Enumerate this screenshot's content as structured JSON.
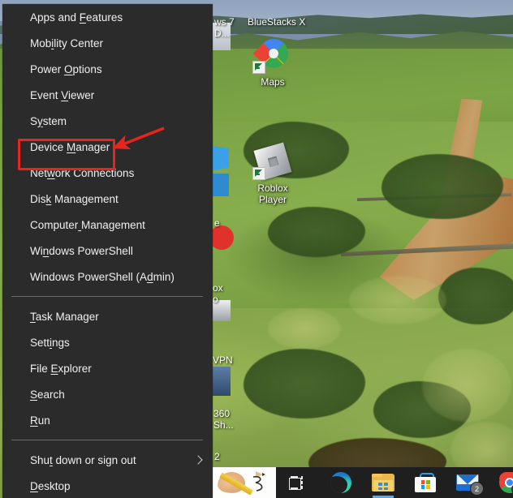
{
  "context_menu": {
    "items": [
      {
        "label": "Apps and Features",
        "accel_index": 9,
        "submenu": false
      },
      {
        "label": "Mobility Center",
        "accel_index": 3,
        "submenu": false
      },
      {
        "label": "Power Options",
        "accel_index": 6,
        "submenu": false
      },
      {
        "label": "Event Viewer",
        "accel_index": 6,
        "submenu": false
      },
      {
        "label": "System",
        "accel_index": 1,
        "submenu": false
      },
      {
        "label": "Device Manager",
        "accel_index": 7,
        "submenu": false
      },
      {
        "label": "Network Connections",
        "accel_index": 3,
        "submenu": false
      },
      {
        "label": "Disk Management",
        "accel_index": 3,
        "submenu": false
      },
      {
        "label": "Computer Management",
        "accel_index": 8,
        "submenu": false
      },
      {
        "label": "Windows PowerShell",
        "accel_index": 2,
        "submenu": false
      },
      {
        "label": "Windows PowerShell (Admin)",
        "accel_index": 21,
        "submenu": false
      },
      {
        "separator": true
      },
      {
        "label": "Task Manager",
        "accel_index": 0,
        "submenu": false
      },
      {
        "label": "Settings",
        "accel_index": 4,
        "submenu": false
      },
      {
        "label": "File Explorer",
        "accel_index": 5,
        "submenu": false
      },
      {
        "label": "Search",
        "accel_index": 0,
        "submenu": false
      },
      {
        "label": "Run",
        "accel_index": 0,
        "submenu": false
      },
      {
        "separator": true
      },
      {
        "label": "Shut down or sign out",
        "accel_index": 3,
        "submenu": true
      },
      {
        "label": "Desktop",
        "accel_index": 0,
        "submenu": false
      }
    ]
  },
  "annotation": {
    "color": "#e8251c",
    "highlighted_item": "Device Manager",
    "shape": "rectangle-with-arrow"
  },
  "desktop": {
    "icons": [
      {
        "name": "windows-7-vhd",
        "label_line1": "ws 7",
        "label_line2": "D...",
        "clipped": true
      },
      {
        "name": "bluestacks-x",
        "label_line1": "BlueStacks X",
        "clipped": true
      },
      {
        "name": "maps",
        "label_line1": "Maps",
        "clipped": false
      },
      {
        "name": "roblox-player",
        "label_line1": "Roblox",
        "label_line2": "Player",
        "clipped": false
      },
      {
        "name": "firefox-partial",
        "label_line1": "ox",
        "label_line2": "o",
        "clipped": true
      },
      {
        "name": "vpn",
        "label_line1": "VPN",
        "clipped": true
      },
      {
        "name": "360-share",
        "label_line1": "360",
        "label_line2": "Sh...",
        "clipped": true
      },
      {
        "name": "item-2",
        "label_line1": "2",
        "clipped": true
      },
      {
        "name": "edge-partial",
        "label_line1": "e",
        "clipped": true
      }
    ]
  },
  "taskbar": {
    "items": [
      {
        "name": "ink-workspace-thumbnail",
        "label": "Pencil sketch preview",
        "badge": null,
        "active": false
      },
      {
        "name": "task-view",
        "label": "Task View",
        "badge": null,
        "active": false
      },
      {
        "name": "microsoft-edge",
        "label": "Microsoft Edge",
        "badge": null,
        "active": false
      },
      {
        "name": "file-explorer",
        "label": "File Explorer",
        "badge": null,
        "active": true
      },
      {
        "name": "microsoft-store",
        "label": "Microsoft Store",
        "badge": null,
        "active": false
      },
      {
        "name": "mail",
        "label": "Mail",
        "badge": "2",
        "active": false
      },
      {
        "name": "google-chrome",
        "label": "Google Chrome",
        "badge": null,
        "active": false
      }
    ]
  },
  "colors": {
    "menu_bg": "#2b2b2b",
    "menu_text": "#f0f0f0",
    "separator": "#6a6a6a",
    "annotation_red": "#e8251c",
    "taskbar_bg": "#1f1f1f",
    "active_underline": "#57a8e8"
  }
}
